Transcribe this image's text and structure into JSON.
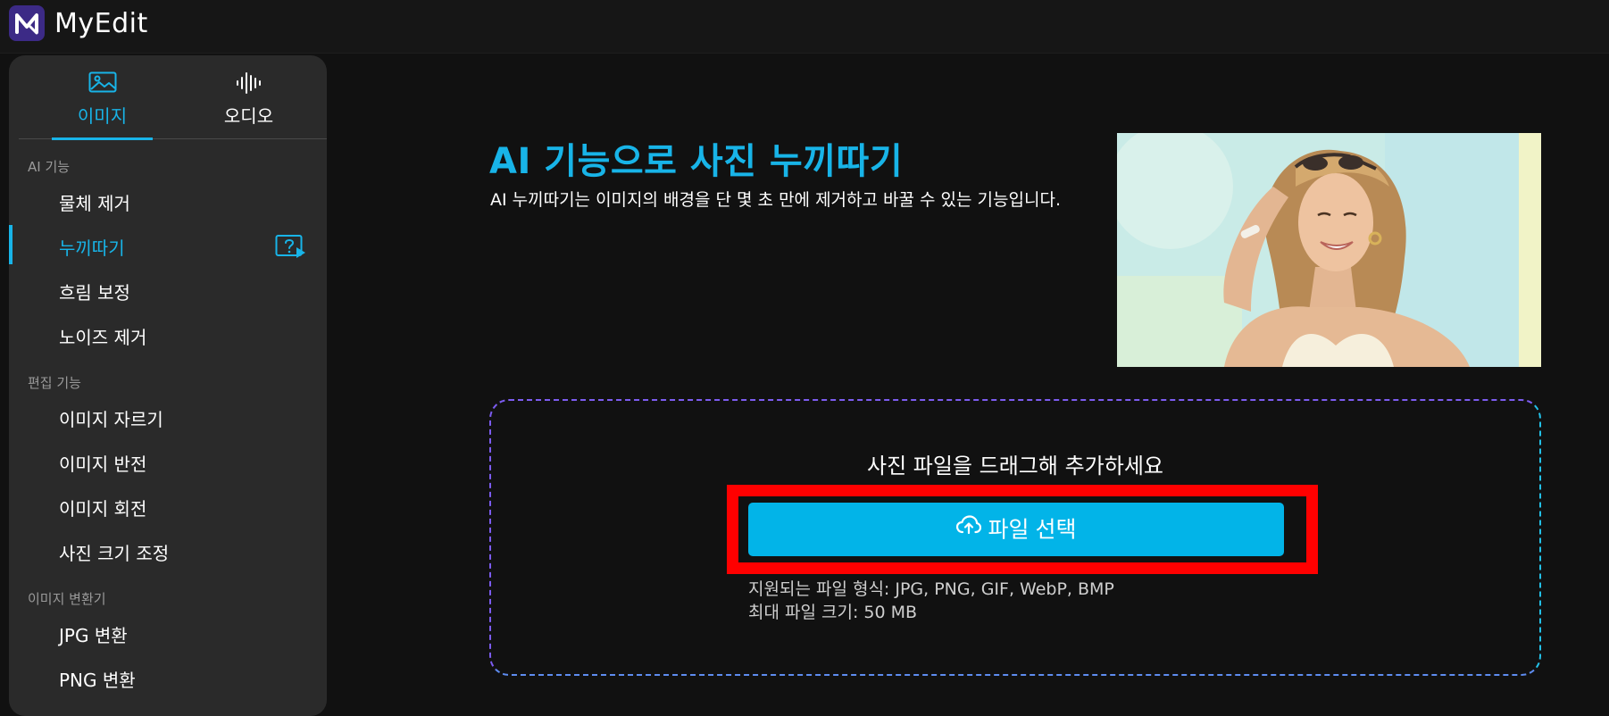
{
  "app": {
    "brand": "MyEdit"
  },
  "sidebar": {
    "tabs": [
      {
        "label": "이미지",
        "icon": "image-icon",
        "active": true
      },
      {
        "label": "오디오",
        "icon": "audio-wave-icon",
        "active": false
      }
    ],
    "sections": [
      {
        "title": "AI 기능",
        "items": [
          {
            "label": "물체 제거"
          },
          {
            "label": "누끼따기",
            "active": true,
            "icon": "tutorial-video-icon"
          },
          {
            "label": "흐림 보정"
          },
          {
            "label": "노이즈 제거"
          }
        ]
      },
      {
        "title": "편집 기능",
        "items": [
          {
            "label": "이미지 자르기"
          },
          {
            "label": "이미지 반전"
          },
          {
            "label": "이미지 회전"
          },
          {
            "label": "사진 크기 조정"
          }
        ]
      },
      {
        "title": "이미지 변환기",
        "items": [
          {
            "label": "JPG 변환"
          },
          {
            "label": "PNG 변환"
          }
        ]
      }
    ]
  },
  "main": {
    "title": "AI 기능으로 사진 누끼따기",
    "description": "AI 누끼따기는 이미지의 배경을 단 몇 초 만에 제거하고 바꿀 수 있는 기능입니다.",
    "upload": {
      "drop_text": "사진 파일을 드래그해 추가하세요",
      "button_label": "파일 선택",
      "button_icon": "cloud-upload-icon",
      "formats": "지원되는 파일 형식: JPG, PNG, GIF, WebP, BMP",
      "max_size": "최대 파일 크기: 50 MB"
    }
  },
  "colors": {
    "accent": "#18b4e8",
    "button": "#02b4e8",
    "highlight": "#ff0000",
    "background": "#111111",
    "sidebar": "#2a2a2a"
  }
}
